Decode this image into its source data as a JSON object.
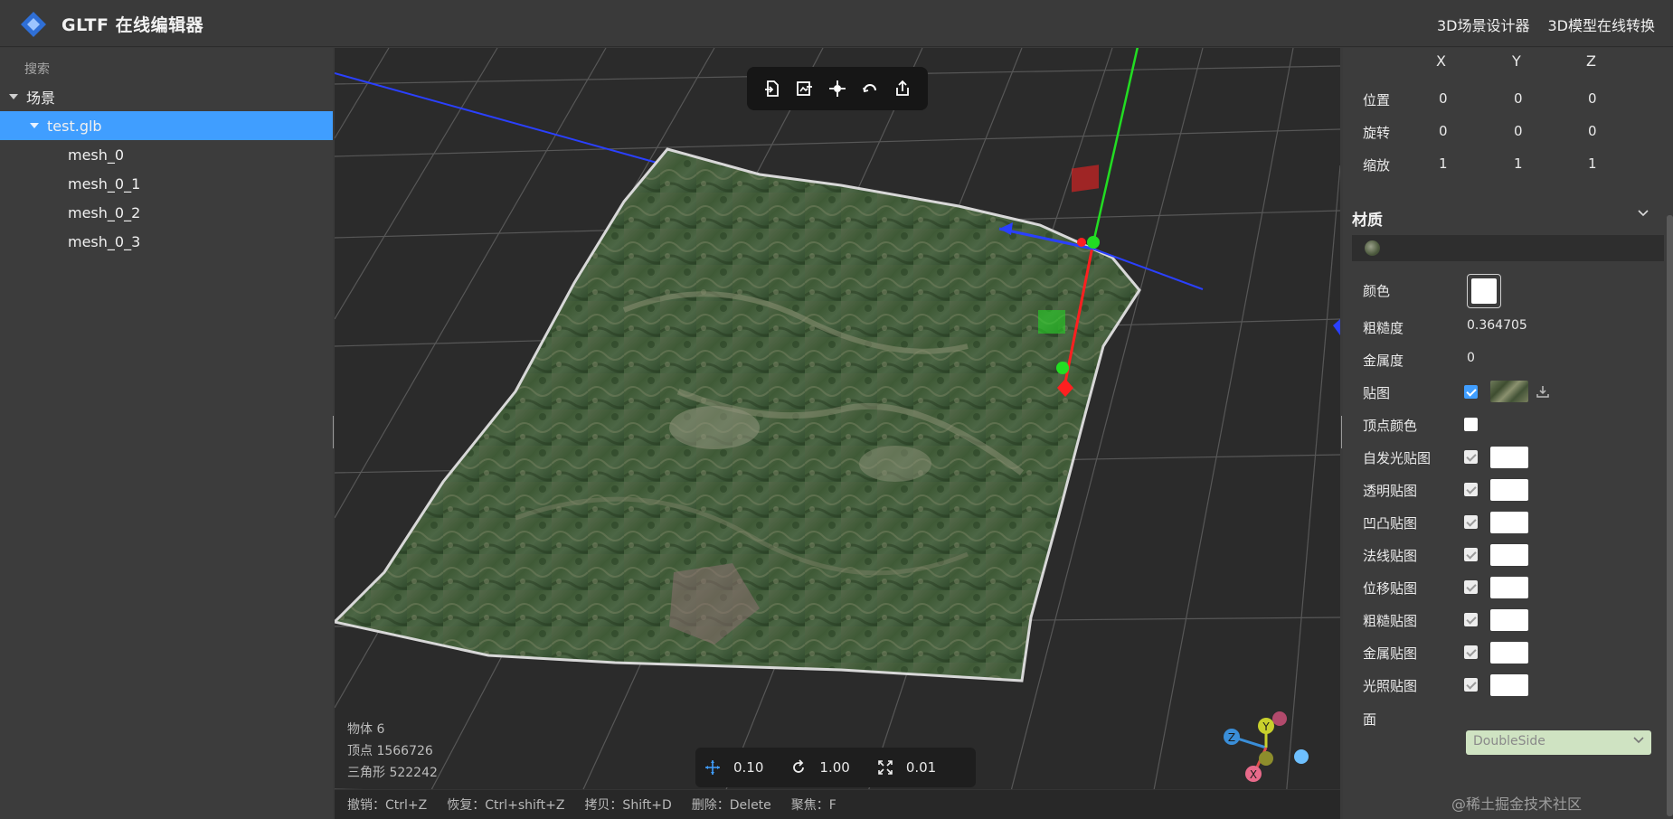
{
  "header": {
    "app_title": "GLTF 在线编辑器",
    "links": [
      "3D场景设计器",
      "3D模型在线转换"
    ]
  },
  "scene_tree": {
    "search_label": "搜索",
    "root": "场景",
    "file": "test.glb",
    "meshes": [
      "mesh_0",
      "mesh_0_1",
      "mesh_0_2",
      "mesh_0_3"
    ]
  },
  "viewport": {
    "stats": [
      "物体 6",
      "顶点 1566726",
      "三角形 522242"
    ],
    "transform": {
      "move": "0.10",
      "rotate": "1.00",
      "scale": "0.01"
    },
    "shortcuts": [
      "撤销：Ctrl+Z",
      "恢复：Ctrl+shift+Z",
      "拷贝：Shift+D",
      "删除：Delete",
      "聚焦：F"
    ],
    "gizmo_axes": [
      "Z",
      "Y",
      "X"
    ],
    "colors": {
      "axis_x": "#ff2020",
      "axis_y": "#22dd22",
      "axis_z": "#2a40ff",
      "selection": "#409eff"
    }
  },
  "properties": {
    "axes": [
      "X",
      "Y",
      "Z"
    ],
    "transform_rows": [
      {
        "label": "位置",
        "values": [
          "0",
          "0",
          "0"
        ]
      },
      {
        "label": "旋转",
        "values": [
          "0",
          "0",
          "0"
        ]
      },
      {
        "label": "缩放",
        "values": [
          "1",
          "1",
          "1"
        ]
      }
    ],
    "material_title": "材质",
    "color_label": "颜色",
    "color_value": "#ffffff",
    "roughness_label": "粗糙度",
    "roughness_value": "0.364705",
    "metalness_label": "金属度",
    "metalness_value": "0",
    "map_label": "贴图",
    "vertex_color_label": "顶点颜色",
    "maps": [
      "自发光贴图",
      "透明贴图",
      "凹凸贴图",
      "法线贴图",
      "位移贴图",
      "粗糙贴图",
      "金属贴图",
      "光照贴图"
    ],
    "side_label": "面",
    "side_value": "DoubleSide"
  },
  "watermark": "@稀土掘金技术社区"
}
